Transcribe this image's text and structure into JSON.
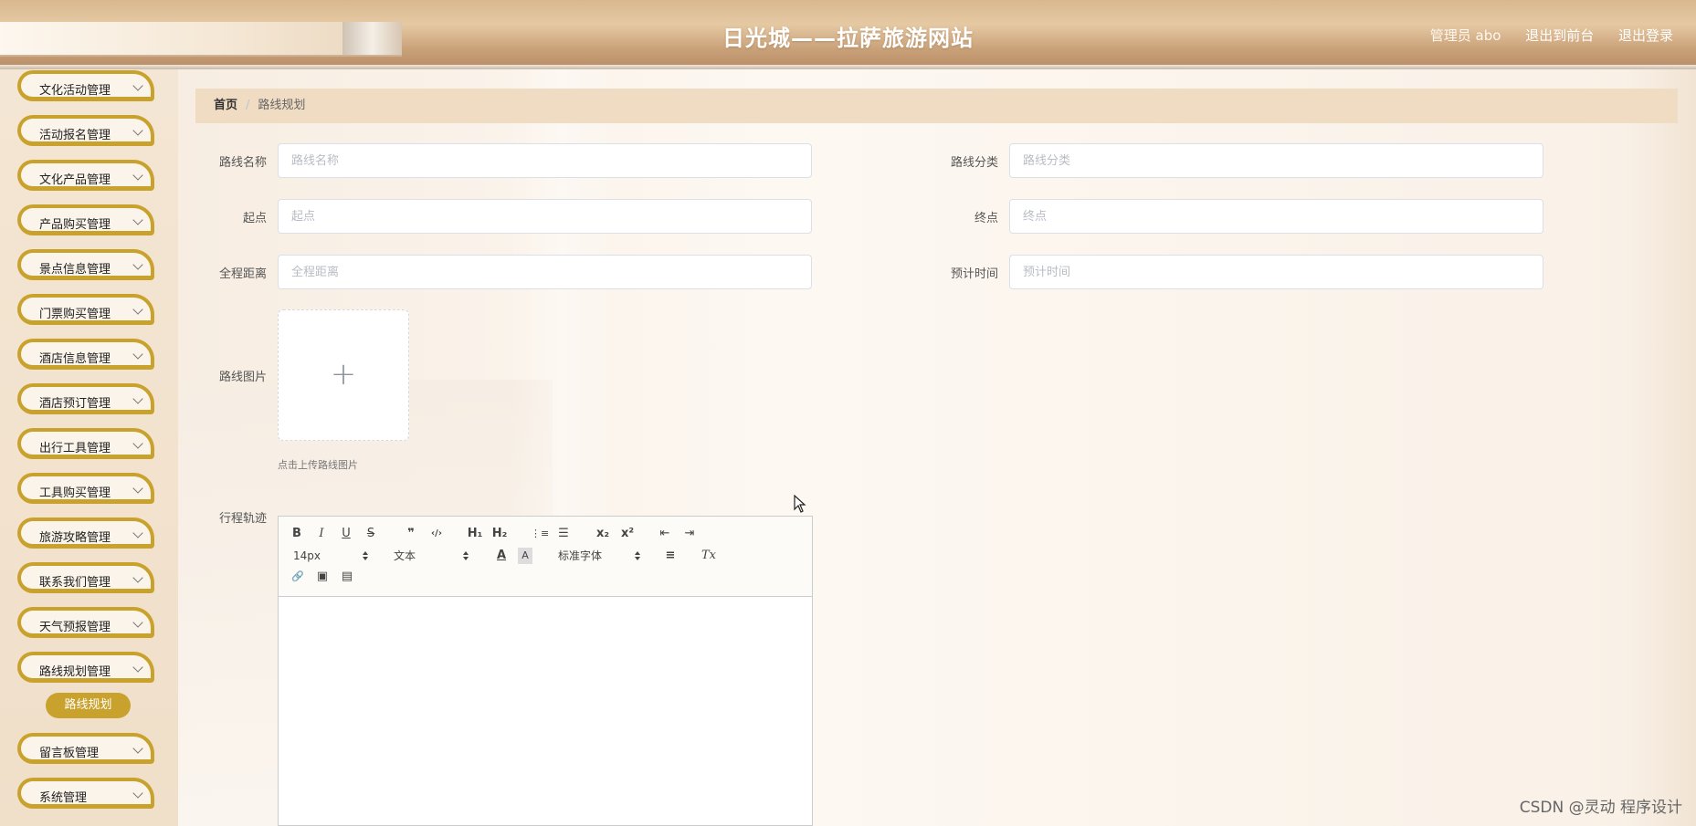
{
  "header": {
    "title": "日光城——拉萨旅游网站",
    "user_label": "管理员 abo",
    "to_front": "退出到前台",
    "logout": "退出登录"
  },
  "sidebar": {
    "items": [
      {
        "label": "文化活动管理"
      },
      {
        "label": "活动报名管理"
      },
      {
        "label": "文化产品管理"
      },
      {
        "label": "产品购买管理"
      },
      {
        "label": "景点信息管理"
      },
      {
        "label": "门票购买管理"
      },
      {
        "label": "酒店信息管理"
      },
      {
        "label": "酒店预订管理"
      },
      {
        "label": "出行工具管理"
      },
      {
        "label": "工具购买管理"
      },
      {
        "label": "旅游攻略管理"
      },
      {
        "label": "联系我们管理"
      },
      {
        "label": "天气预报管理"
      },
      {
        "label": "路线规划管理"
      },
      {
        "label": "留言板管理"
      },
      {
        "label": "系统管理"
      }
    ],
    "active_sub": "路线规划"
  },
  "breadcrumb": {
    "home": "首页",
    "separator": "/",
    "current": "路线规划"
  },
  "form": {
    "route_name": {
      "label": "路线名称",
      "placeholder": "路线名称",
      "value": ""
    },
    "route_category": {
      "label": "路线分类",
      "placeholder": "路线分类",
      "value": ""
    },
    "start": {
      "label": "起点",
      "placeholder": "起点",
      "value": ""
    },
    "end": {
      "label": "终点",
      "placeholder": "终点",
      "value": ""
    },
    "distance": {
      "label": "全程距离",
      "placeholder": "全程距离",
      "value": ""
    },
    "est_time": {
      "label": "预计时间",
      "placeholder": "预计时间",
      "value": ""
    },
    "image": {
      "label": "路线图片",
      "plus": "+",
      "tip": "点击上传路线图片"
    },
    "itinerary": {
      "label": "行程轨迹"
    }
  },
  "editor": {
    "bold": "B",
    "italic": "I",
    "underline": "U",
    "strike": "S",
    "quote": "❞",
    "code": "‹/›",
    "h1": "H₁",
    "h2": "H₂",
    "ol": "⋮≡",
    "ul": "☰",
    "sub": "x₂",
    "sup": "x²",
    "outdent": "⇤",
    "indent": "⇥",
    "size": "14px",
    "header_select": "文本",
    "font_color": "A",
    "bg_color": "A",
    "font_select": "标准字体",
    "align": "≡",
    "clean": "Tx",
    "link": "🔗",
    "image": "▣",
    "video": "▤",
    "content": ""
  },
  "watermark": "CSDN @灵动 程序设计",
  "colors": {
    "accent": "#c9a22e",
    "breadcrumb_bg": "#efdcc3",
    "header": "#d8b88e"
  }
}
